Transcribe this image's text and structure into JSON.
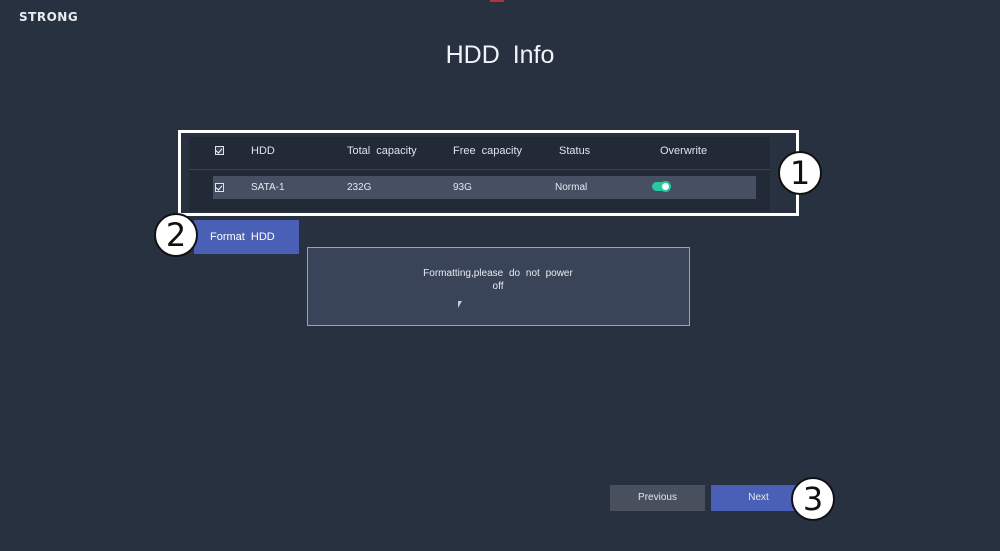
{
  "brand": "STRONG",
  "page_title": "HDD  Info",
  "table": {
    "columns": [
      "HDD",
      "Total  capacity",
      "Free  capacity",
      "Status",
      "Overwrite"
    ],
    "rows": [
      {
        "checked": true,
        "hdd": "SATA-1",
        "total_capacity": "232G",
        "free_capacity": "93G",
        "status": "Normal",
        "overwrite": true
      }
    ]
  },
  "buttons": {
    "format_hdd": "Format  HDD",
    "previous": "Previous",
    "next": "Next"
  },
  "dialog": {
    "line1": "Formatting,please  do  not  power",
    "line2": "off"
  },
  "annotations": [
    "1",
    "2",
    "3"
  ],
  "icons": {
    "checkbox": "checkbox-checked-icon",
    "toggle": "toggle-on-icon",
    "cursor": "mouse-pointer-icon"
  },
  "colors": {
    "background": "#28313f",
    "accent": "#4a5fb6",
    "toggle_on": "#25c8a0",
    "dialog_border": "#7fa8e8"
  }
}
